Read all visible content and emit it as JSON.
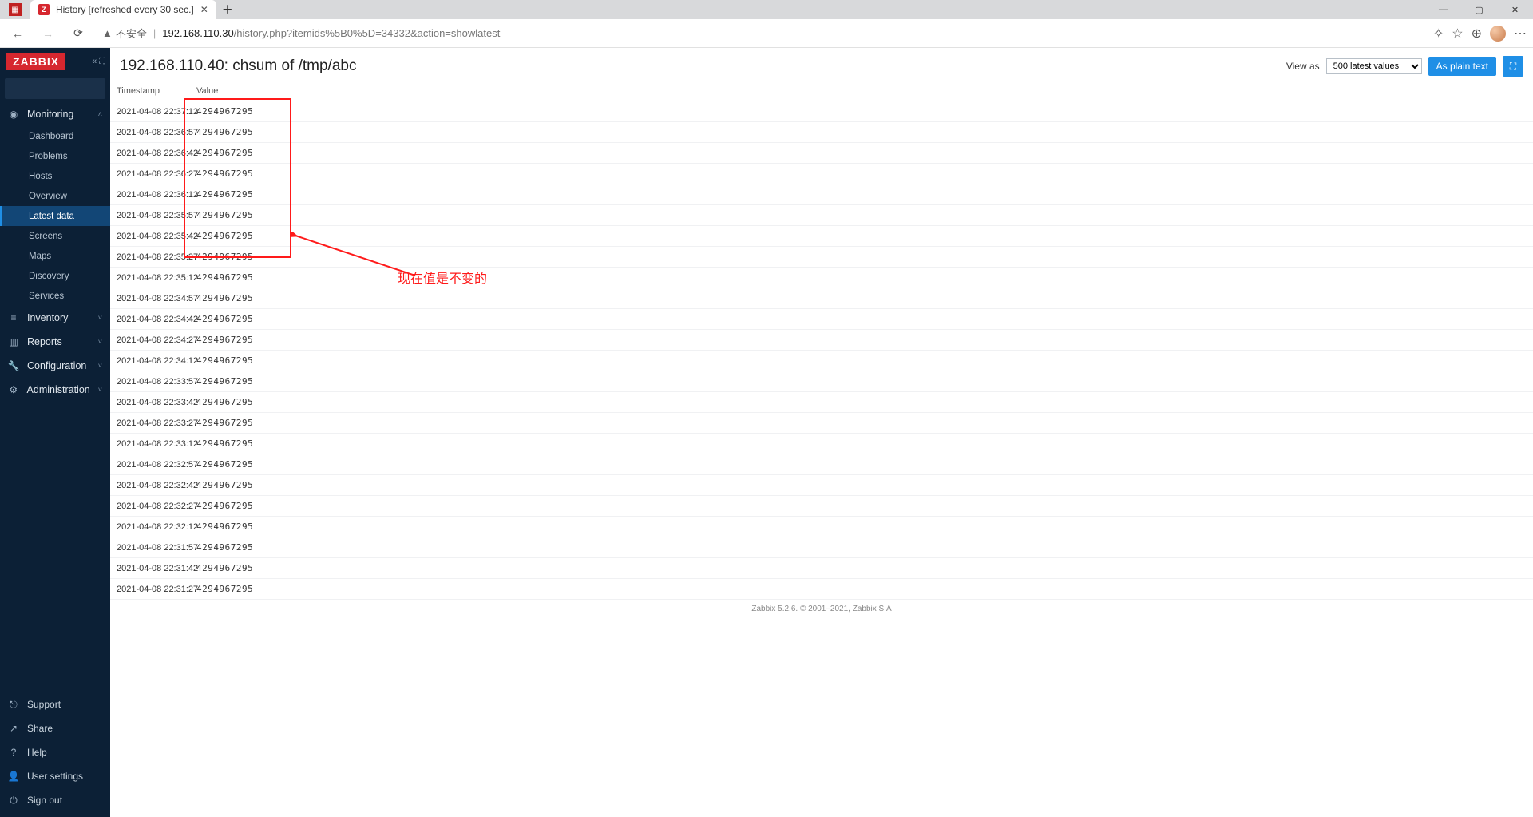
{
  "browser": {
    "tab_title": "History [refreshed every 30 sec.]",
    "insecure_label": "不安全",
    "url_host": "192.168.110.30",
    "url_path": "/history.php?itemids%5B0%5D=34332&action=showlatest"
  },
  "sidebar": {
    "logo": "ZABBIX",
    "search_placeholder": "",
    "monitoring": {
      "label": "Monitoring",
      "items": [
        {
          "label": "Dashboard"
        },
        {
          "label": "Problems"
        },
        {
          "label": "Hosts"
        },
        {
          "label": "Overview"
        },
        {
          "label": "Latest data",
          "active": true
        },
        {
          "label": "Screens"
        },
        {
          "label": "Maps"
        },
        {
          "label": "Discovery"
        },
        {
          "label": "Services"
        }
      ]
    },
    "inventory": {
      "label": "Inventory"
    },
    "reports": {
      "label": "Reports"
    },
    "configuration": {
      "label": "Configuration"
    },
    "administration": {
      "label": "Administration"
    },
    "bottom": [
      {
        "label": "Support",
        "icon": "support"
      },
      {
        "label": "Share",
        "icon": "share"
      },
      {
        "label": "Help",
        "icon": "help"
      },
      {
        "label": "User settings",
        "icon": "user"
      },
      {
        "label": "Sign out",
        "icon": "signout"
      }
    ]
  },
  "page": {
    "title": "192.168.110.40: chsum of /tmp/abc",
    "view_as_label": "View as",
    "view_as_value": "500 latest values",
    "plain_text_btn": "As plain text"
  },
  "table": {
    "col_timestamp": "Timestamp",
    "col_value": "Value",
    "rows": [
      {
        "ts": "2021-04-08 22:37:12",
        "val": "4294967295"
      },
      {
        "ts": "2021-04-08 22:36:57",
        "val": "4294967295"
      },
      {
        "ts": "2021-04-08 22:36:42",
        "val": "4294967295"
      },
      {
        "ts": "2021-04-08 22:36:27",
        "val": "4294967295"
      },
      {
        "ts": "2021-04-08 22:36:12",
        "val": "4294967295"
      },
      {
        "ts": "2021-04-08 22:35:57",
        "val": "4294967295"
      },
      {
        "ts": "2021-04-08 22:35:42",
        "val": "4294967295"
      },
      {
        "ts": "2021-04-08 22:35:27",
        "val": "4294967295"
      },
      {
        "ts": "2021-04-08 22:35:12",
        "val": "4294967295"
      },
      {
        "ts": "2021-04-08 22:34:57",
        "val": "4294967295"
      },
      {
        "ts": "2021-04-08 22:34:42",
        "val": "4294967295"
      },
      {
        "ts": "2021-04-08 22:34:27",
        "val": "4294967295"
      },
      {
        "ts": "2021-04-08 22:34:12",
        "val": "4294967295"
      },
      {
        "ts": "2021-04-08 22:33:57",
        "val": "4294967295"
      },
      {
        "ts": "2021-04-08 22:33:42",
        "val": "4294967295"
      },
      {
        "ts": "2021-04-08 22:33:27",
        "val": "4294967295"
      },
      {
        "ts": "2021-04-08 22:33:12",
        "val": "4294967295"
      },
      {
        "ts": "2021-04-08 22:32:57",
        "val": "4294967295"
      },
      {
        "ts": "2021-04-08 22:32:42",
        "val": "4294967295"
      },
      {
        "ts": "2021-04-08 22:32:27",
        "val": "4294967295"
      },
      {
        "ts": "2021-04-08 22:32:12",
        "val": "4294967295"
      },
      {
        "ts": "2021-04-08 22:31:57",
        "val": "4294967295"
      },
      {
        "ts": "2021-04-08 22:31:42",
        "val": "4294967295"
      },
      {
        "ts": "2021-04-08 22:31:27",
        "val": "4294967295"
      }
    ]
  },
  "annotation": {
    "text": "现在值是不变的"
  },
  "footer": "Zabbix 5.2.6. © 2001–2021, Zabbix SIA"
}
